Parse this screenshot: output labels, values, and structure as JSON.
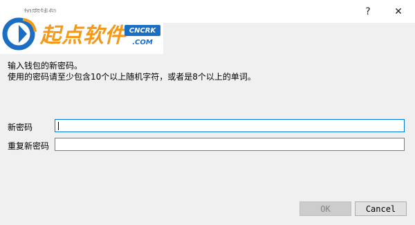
{
  "window": {
    "title": "加密钱包",
    "help_glyph": "?",
    "close_glyph": "✕"
  },
  "watermark": {
    "text": "起点软件",
    "badge": "CNCRK",
    "domain": ".COM"
  },
  "message": {
    "line1": "输入钱包的新密码。",
    "line2": "使用的密码请至少包含10个以上随机字符，或者是8个以上的单词。"
  },
  "form": {
    "new_passphrase_label": "新密码",
    "new_passphrase_value": "",
    "repeat_passphrase_label": "重复新密码",
    "repeat_passphrase_value": ""
  },
  "buttons": {
    "ok": "OK",
    "cancel": "Cancel"
  }
}
